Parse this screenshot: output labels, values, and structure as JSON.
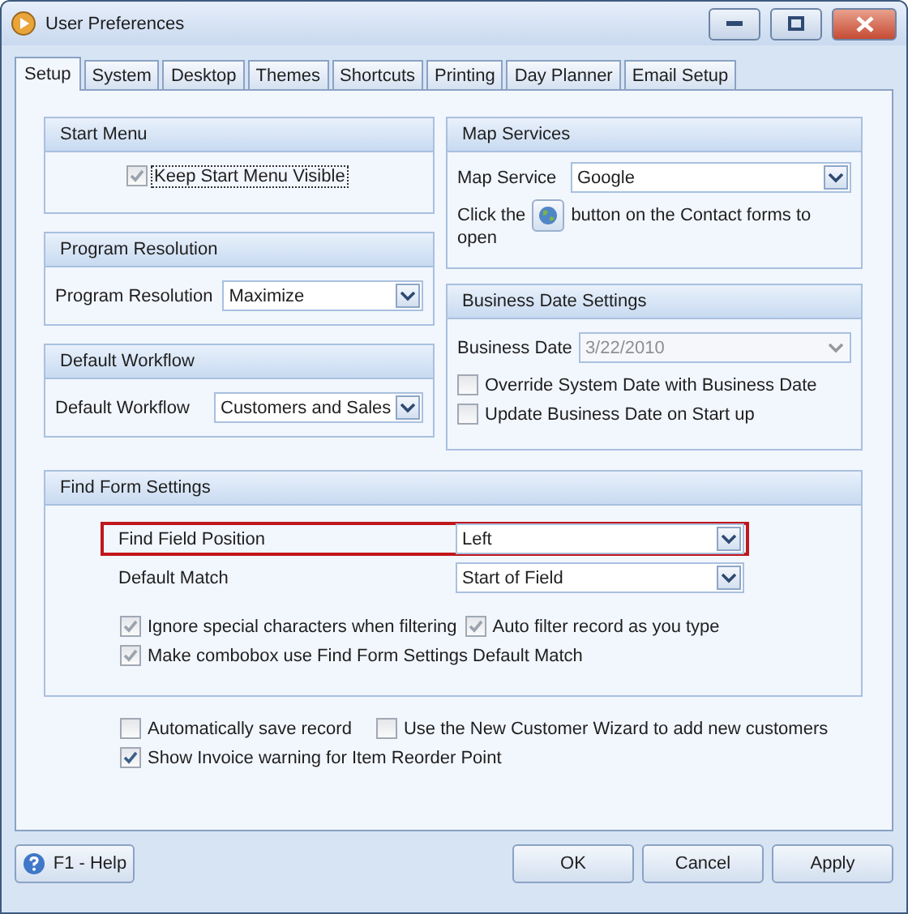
{
  "window": {
    "title": "User Preferences"
  },
  "tabs": [
    {
      "label": "Setup",
      "selected": true
    },
    {
      "label": "System",
      "selected": false
    },
    {
      "label": "Desktop",
      "selected": false
    },
    {
      "label": "Themes",
      "selected": false
    },
    {
      "label": "Shortcuts",
      "selected": false
    },
    {
      "label": "Printing",
      "selected": false
    },
    {
      "label": "Day Planner",
      "selected": false
    },
    {
      "label": "Email Setup",
      "selected": false
    }
  ],
  "left_groups": [
    {
      "title": "Start Menu",
      "kind": "checkbox",
      "label": "Keep Start Menu Visible",
      "checked": true,
      "disabled": true,
      "focused": true
    },
    {
      "title": "Program Resolution",
      "kind": "dropdown",
      "label": "Program Resolution",
      "value": "Maximize"
    },
    {
      "title": "Default Workflow",
      "kind": "dropdown",
      "label": "Default Workflow",
      "value": "Customers and Sales"
    }
  ],
  "map_services": {
    "title": "Map Services",
    "label": "Map Service",
    "value": "Google",
    "note_before": "Click the",
    "note_after": "button on the Contact forms to",
    "note_wrap": "open"
  },
  "business_date": {
    "title": "Business Date Settings",
    "label": "Business Date",
    "value": "3/22/2010",
    "disabled": true,
    "checkboxes": [
      {
        "label": "Override System Date with Business Date",
        "checked": false
      },
      {
        "label": "Update Business Date on Start up",
        "checked": false
      }
    ]
  },
  "find_form": {
    "title": "Find Form Settings",
    "fields": [
      {
        "label": "Find Field Position",
        "value": "Left",
        "highlighted": true
      },
      {
        "label": "Default Match",
        "value": "Start of Field",
        "highlighted": false
      }
    ],
    "checkboxes": [
      {
        "label": "Ignore special characters when filtering",
        "checked": true,
        "disabled": true
      },
      {
        "label": "Auto filter record as you type",
        "checked": true,
        "disabled": true
      },
      {
        "label": "Make combobox use Find Form Settings Default Match",
        "checked": true,
        "disabled": true
      }
    ]
  },
  "options": [
    {
      "label": "Automatically save record",
      "checked": false
    },
    {
      "label": "Use the New Customer Wizard to add new customers",
      "checked": false
    },
    {
      "label": "Show Invoice warning for Item Reorder Point",
      "checked": true,
      "disabled": false
    }
  ],
  "help_button": "F1 - Help",
  "buttons": [
    "OK",
    "Cancel",
    "Apply"
  ]
}
